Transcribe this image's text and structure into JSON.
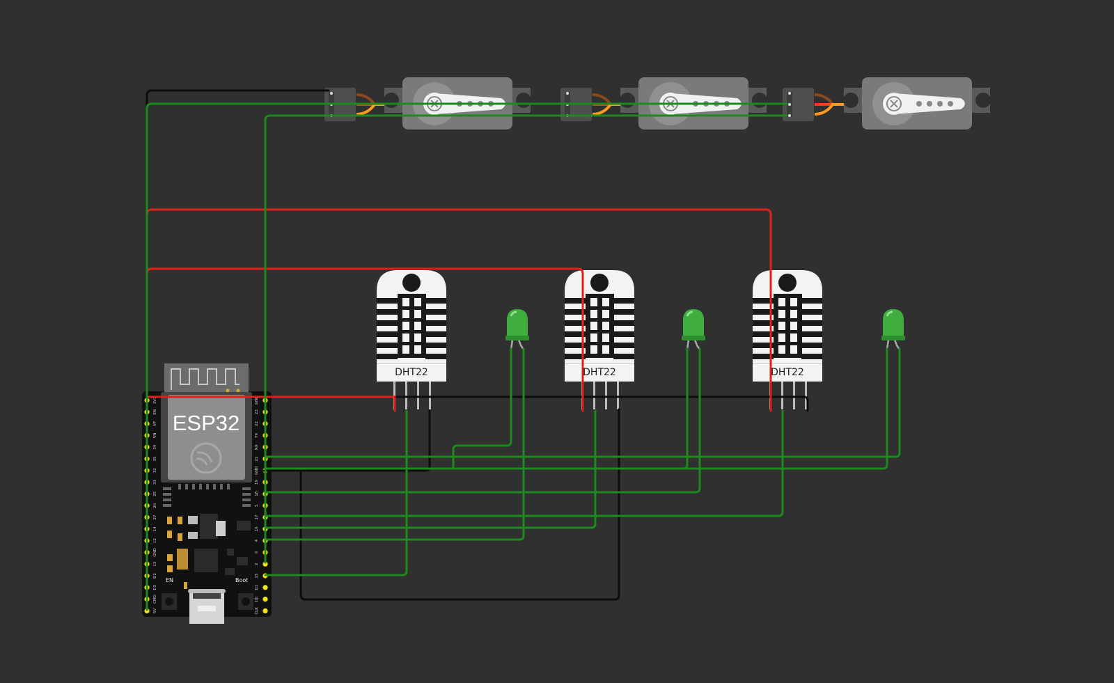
{
  "simulator": {
    "background": "#303030",
    "wire_colors": {
      "green": "#1d8a1d",
      "red": "#e0201c",
      "black": "#0c0c0c"
    }
  },
  "board": {
    "name": "ESP32",
    "left_pins": [
      "3V3",
      "EN",
      "VP",
      "VN",
      "34",
      "35",
      "32",
      "33",
      "25",
      "26",
      "27",
      "14",
      "12",
      "GND",
      "13",
      "D2",
      "D3",
      "CMD",
      "5V"
    ],
    "right_pins": [
      "GND",
      "23",
      "22",
      "TX",
      "RX",
      "21",
      "GND",
      "19",
      "18",
      "5",
      "17",
      "16",
      "4",
      "0",
      "2",
      "15",
      "D1",
      "D0",
      "CLK"
    ],
    "buttons": {
      "en": "EN",
      "boot": "Boot"
    }
  },
  "sensors": [
    {
      "label": "DHT22"
    },
    {
      "label": "DHT22"
    },
    {
      "label": "DHT22"
    }
  ],
  "leds": [
    {
      "color": "#3fae3f"
    },
    {
      "color": "#3fae3f"
    },
    {
      "color": "#3fae3f"
    }
  ],
  "servos": [
    {
      "horn": "servo-horn-icon"
    },
    {
      "horn": "servo-horn-icon"
    },
    {
      "horn": "servo-horn-icon"
    }
  ]
}
